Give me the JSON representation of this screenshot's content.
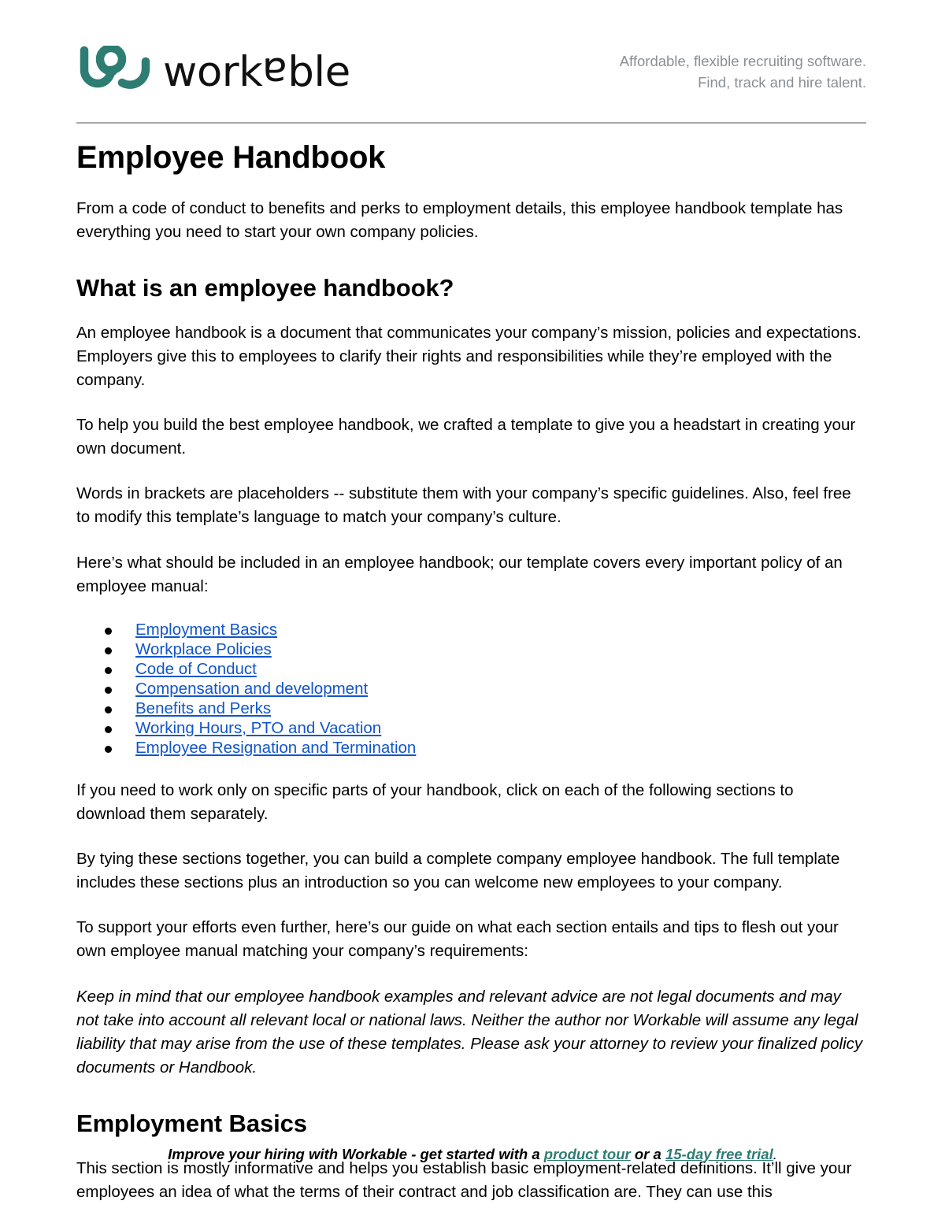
{
  "header": {
    "logo_mark_name": "workable-swirl-logo",
    "brand_name_part1": "work",
    "brand_name_flip": "a",
    "brand_name_part2": "ble",
    "brand_full": "workable",
    "tagline_line1": "Affordable, flexible recruiting software.",
    "tagline_line2": "Find, track and hire talent.",
    "brand_color": "#2e7d72",
    "tagline_color": "#8a8f96",
    "rule_color": "#a8a8a8"
  },
  "document": {
    "title": "Employee Handbook",
    "intro": "From a code of conduct to benefits and perks to employment details, this employee handbook template has everything you need to start your own company policies.",
    "section_what_is": {
      "heading": "What is an employee handbook?",
      "p1": "An employee handbook is a document that communicates your company’s mission, policies and expectations. Employers give this to employees to clarify their rights and responsibilities while they’re employed with the company.",
      "p2": "To help you build the best employee handbook, we crafted a template to give you a headstart in creating your own document.",
      "p3": "Words in brackets are placeholders -- substitute them with your company’s specific guidelines. Also, feel free to modify this template’s language to match your company’s culture.",
      "p4": "Here’s what should be included in an employee handbook; our template covers every important policy of an employee manual:",
      "p5": "If you need to work only on specific parts of your handbook, click on each of the following sections to download them separately.",
      "p6": "By tying these sections together, you can build a complete company employee handbook. The full template includes these sections plus an introduction so you can welcome new employees to your company.",
      "p7": "To support your efforts even further, here’s our guide on what each section entails and tips to flesh out your own employee manual matching your company’s requirements:",
      "disclaimer": "Keep in mind that our employee handbook examples and relevant advice are not legal documents and may not take into account all relevant local or national laws. Neither the author nor Workable will assume any legal liability that may arise from the use of these templates. Please ask your attorney to review your finalized policy documents or Handbook."
    },
    "toc_links": [
      {
        "label": "Employment Basics"
      },
      {
        "label": "Workplace Policies"
      },
      {
        "label": "Code of Conduct"
      },
      {
        "label": "Compensation and development"
      },
      {
        "label": "Benefits and Perks"
      },
      {
        "label": "Working Hours, PTO and Vacation"
      },
      {
        "label": "Employee Resignation and Termination"
      }
    ],
    "link_color": "#1155cc",
    "section_employment_basics": {
      "heading": "Employment Basics",
      "p1": "This section is mostly informative and helps you establish basic employment-related definitions. It’ll give your employees an idea of what the terms of their contract and job classification are. They can use this"
    }
  },
  "footer": {
    "text_before": "Improve your hiring with Workable - get started with a ",
    "link1": "product tour",
    "text_middle": " or a ",
    "link2": "15-day free trial",
    "text_after": ".",
    "link_color": "#2e7d72"
  }
}
